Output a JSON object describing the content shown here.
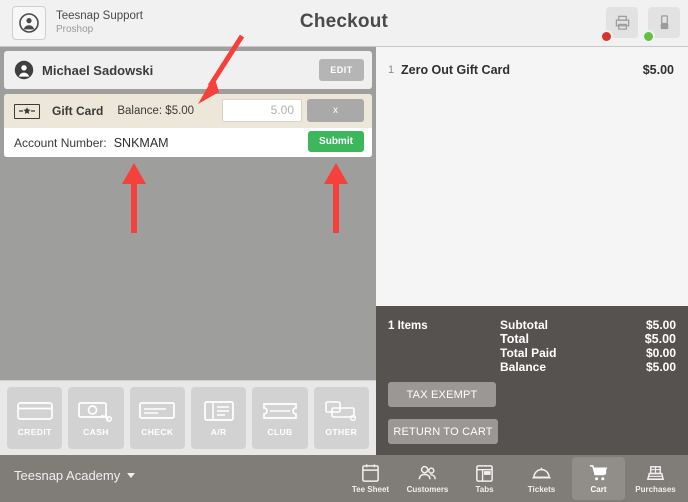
{
  "header": {
    "account_name": "Teesnap Support",
    "account_sub": "Proshop",
    "title": "Checkout",
    "avatar_icon": "user-circle-icon",
    "buttons": [
      {
        "name": "printer-icon",
        "status": "red",
        "status_color": "#d9342b"
      },
      {
        "name": "card-reader-icon",
        "status": "green",
        "status_color": "#62c13f"
      }
    ]
  },
  "customer": {
    "name": "Michael Sadowski",
    "edit_label": "EDIT",
    "avatar_icon": "user-circle-icon"
  },
  "gift_card": {
    "icon": "gift-card-icon",
    "label": "Gift Card",
    "balance_label": "Balance: $5.00",
    "amount_value": "5.00",
    "amount_placeholder": "5.00",
    "remove_label": "x",
    "account_label": "Account Number:",
    "account_value": "SNKMAM",
    "submit_label": "Submit",
    "submit_color": "#3cb75c"
  },
  "payment_methods": [
    {
      "label": "CREDIT",
      "icon": "credit-card-icon"
    },
    {
      "label": "CASH",
      "icon": "cash-icon"
    },
    {
      "label": "CHECK",
      "icon": "check-icon"
    },
    {
      "label": "A/R",
      "icon": "ledger-icon"
    },
    {
      "label": "CLUB",
      "icon": "club-ticket-icon"
    },
    {
      "label": "OTHER",
      "icon": "other-payment-icon"
    }
  ],
  "cart": {
    "items": [
      {
        "qty": "1",
        "name": "Zero Out Gift Card",
        "price": "$5.00"
      }
    ]
  },
  "summary": {
    "items_count": "1 Items",
    "lines": [
      {
        "key": "Subtotal",
        "value": "$5.00"
      },
      {
        "key": "Total",
        "value": "$5.00"
      },
      {
        "key": "Total Paid",
        "value": "$0.00"
      },
      {
        "key": "Balance",
        "value": "$5.00"
      }
    ],
    "tax_exempt_label": "TAX EXEMPT",
    "return_to_cart_label": "RETURN TO CART"
  },
  "bottom": {
    "academy_label": "Teesnap Academy",
    "nav": [
      {
        "label": "Tee Sheet",
        "icon": "calendar-icon",
        "active": false
      },
      {
        "label": "Customers",
        "icon": "people-icon",
        "active": false
      },
      {
        "label": "Tabs",
        "icon": "tabs-icon",
        "active": false
      },
      {
        "label": "Tickets",
        "icon": "bell-icon",
        "active": false
      },
      {
        "label": "Cart",
        "icon": "shopping-cart-icon",
        "active": true
      },
      {
        "label": "Purchases",
        "icon": "register-icon",
        "active": false
      }
    ]
  },
  "annotations": {
    "color": "#f5403b",
    "arrows": [
      {
        "name": "arrow-to-amount-field",
        "kind": "diagonal"
      },
      {
        "name": "arrow-to-account-number",
        "kind": "vertical"
      },
      {
        "name": "arrow-to-submit-button",
        "kind": "vertical"
      }
    ]
  }
}
